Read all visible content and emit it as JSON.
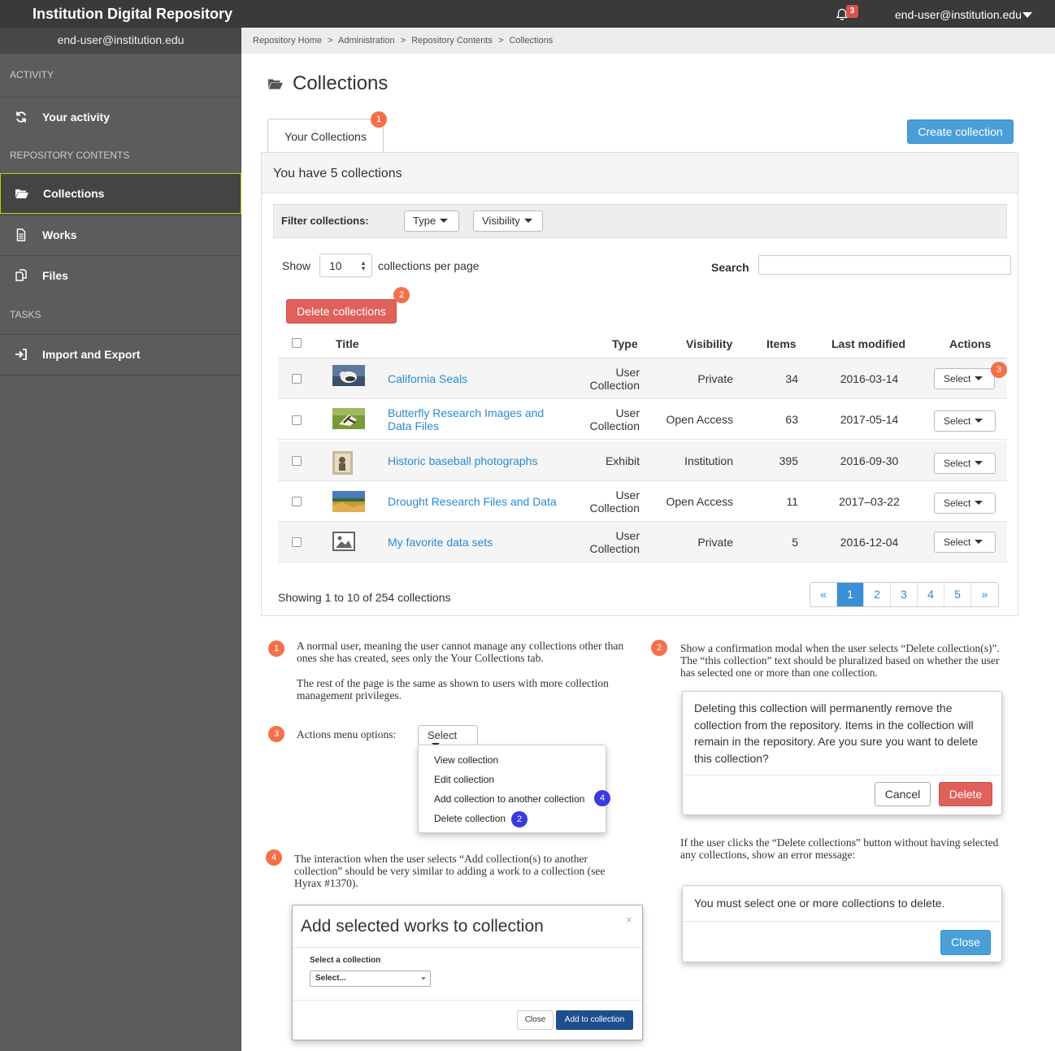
{
  "app": {
    "title": "Institution Digital Repository",
    "notification_count": "3",
    "user": "end-user@institution.edu"
  },
  "sidebar": {
    "user": "end-user@institution.edu",
    "sections": {
      "activity": "ACTIVITY",
      "repository": "REPOSITORY CONTENTS",
      "tasks": "TASKS"
    },
    "items": [
      {
        "label": "Your activity",
        "icon": "refresh-icon"
      },
      {
        "label": "Collections",
        "icon": "folder-open-icon",
        "active": true
      },
      {
        "label": "Works",
        "icon": "file-icon"
      },
      {
        "label": "Files",
        "icon": "files-icon"
      },
      {
        "label": "Import and Export",
        "icon": "sign-in-icon"
      }
    ]
  },
  "breadcrumb": [
    "Repository Home",
    "Administration",
    "Repository Contents",
    "Collections"
  ],
  "breadcrumb_sep": ">",
  "page": {
    "title": "Collections",
    "tab": "Your Collections",
    "create_button": "Create collection"
  },
  "panel": {
    "heading": "You have 5 collections",
    "filter_label": "Filter collections:",
    "filters": [
      "Type",
      "Visibility"
    ],
    "show_label": "Show",
    "per_page_value": "10",
    "per_page_label": "collections per page",
    "search_label": "Search",
    "delete_button": "Delete collections",
    "columns": {
      "title": "Title",
      "type": "Type",
      "visibility": "Visibility",
      "items": "Items",
      "last_modified": "Last modified",
      "actions": "Actions"
    },
    "rows": [
      {
        "title": "California Seals",
        "type": "User Collection",
        "visibility": "Private",
        "items": "34",
        "modified": "2016-03-14",
        "action": "Select"
      },
      {
        "title": "Butterfly Research Images and Data Files",
        "type": "User Collection",
        "visibility": "Open Access",
        "items": "63",
        "modified": "2017-05-14",
        "action": "Select"
      },
      {
        "title": "Historic baseball photographs",
        "type": "Exhibit",
        "visibility": "Institution",
        "items": "395",
        "modified": "2016-09-30",
        "action": "Select"
      },
      {
        "title": "Drought Research Files and Data",
        "type": "User Collection",
        "visibility": "Open Access",
        "items": "11",
        "modified": "2017–03-22",
        "action": "Select"
      },
      {
        "title": "My favorite data sets",
        "type": "User Collection",
        "visibility": "Private",
        "items": "5",
        "modified": "2016-12-04",
        "action": "Select"
      }
    ],
    "showing": "Showing 1 to 10 of 254 collections",
    "pager": [
      "«",
      "1",
      "2",
      "3",
      "4",
      "5",
      "»"
    ],
    "current_page": "1"
  },
  "badges": {
    "one": "1",
    "two": "2",
    "three": "3",
    "four": "4"
  },
  "notes": {
    "n1a": "A normal user, meaning the user cannot manage any collections other than ones she has created, sees only the Your Collections tab.",
    "n1b": "The rest of the page is the same as shown to users with more collection management privileges.",
    "n2": "Show a confirmation modal when the user selects “Delete collection(s)”. The “this collection” text should be pluralized based on whether the user has selected one or more than one collection.",
    "n3": "Actions menu options:",
    "n4": "The interaction when the user selects “Add collection(s) to another collection” should be very similar to adding a work to a collection (see Hyrax #1370).",
    "n5": "If the user clicks the “Delete collections” button without having selected any collections, show an error message:"
  },
  "actions_menu": {
    "button": "Select",
    "items": [
      "View collection",
      "Edit collection",
      "Add collection to another collection",
      "Delete collection"
    ]
  },
  "confirm_modal": {
    "text": "Deleting this collection will permanently remove the collection from the repository. Items in the collection will remain in the repository. Are you sure you want to delete this collection?",
    "cancel": "Cancel",
    "delete": "Delete"
  },
  "error_modal": {
    "text": "You must select one or more collections to delete.",
    "close": "Close"
  },
  "add_modal": {
    "title": "Add selected works to collection",
    "close_x": "×",
    "field_label": "Select a collection",
    "select_placeholder": "Select...",
    "close": "Close",
    "submit": "Add to collection"
  }
}
